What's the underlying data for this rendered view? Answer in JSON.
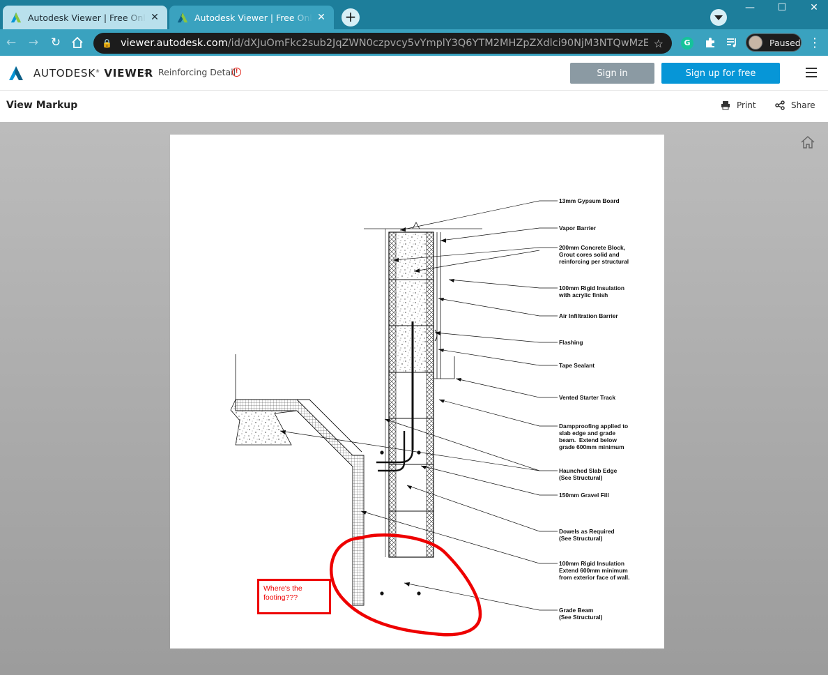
{
  "browser": {
    "tabs": [
      {
        "title": "Autodesk Viewer | Free Online File Viewer",
        "active": false
      },
      {
        "title": "Autodesk Viewer | Free Online File Viewer",
        "active": true
      }
    ],
    "new_tab": "+",
    "url_host": "viewer.autodesk.com",
    "url_path": "/id/dXJuOmFkc2sub2JqZWN0czpvcy5vYmplY3Q6YTM2MHZpZXdlci90NjM3NTQwMzEwNzEzOTQ0N...",
    "profile_status": "Paused",
    "accent": "#3aa2bf",
    "tabstrip_color": "#1d7e9b"
  },
  "app": {
    "brand_light": "AUTODESK",
    "brand_bold": "VIEWER",
    "document_name": "Reinforcing Detail",
    "sign_in": "Sign in",
    "sign_up": "Sign up for free",
    "view_markup": "View Markup",
    "print": "Print",
    "share": "Share",
    "signup_color": "#0696d7",
    "signin_color": "#8b9aa3"
  },
  "drawing": {
    "labels": [
      "13mm Gypsum Board",
      "Vapor Barrier",
      "200mm Concrete Block,\nGrout cores solid and\nreinforcing per structural",
      "100mm Rigid Insulation\nwith acrylic finish",
      "Air Infiltration Barrier",
      "Flashing",
      "Tape Sealant",
      "Vented Starter Track",
      "Dampproofing applied to\nslab edge and grade\nbeam.  Extend below\ngrade 600mm minimum",
      "Haunched Slab Edge\n(See Structural)",
      "150mm Gravel Fill",
      "Dowels as Required\n(See Structural)",
      "100mm Rigid Insulation\nExtend 600mm minimum\nfrom exterior face of wall.",
      "Grade Beam\n(See Structural)"
    ]
  },
  "markup": {
    "comment": "Where's the footing???",
    "markup_color": "#ee0000"
  }
}
